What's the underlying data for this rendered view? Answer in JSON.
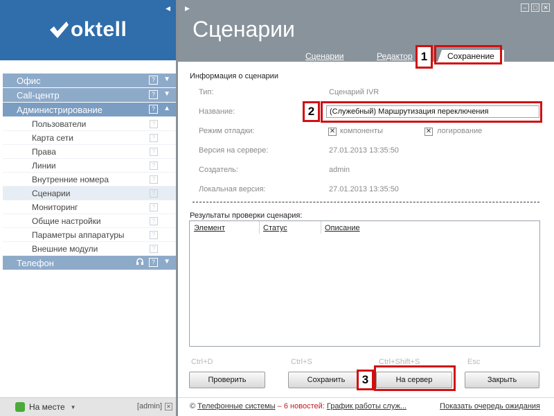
{
  "brand": {
    "logo_text": "oktell",
    "color_logo_bg": "#2f6dab",
    "color_header_bg": "#89939b"
  },
  "nav": {
    "sections": [
      {
        "label": "Офис"
      },
      {
        "label": "Call-центр"
      },
      {
        "label": "Администрирование"
      },
      {
        "label": "Телефон"
      }
    ],
    "admin_items": [
      {
        "label": "Пользователи"
      },
      {
        "label": "Карта сети"
      },
      {
        "label": "Права"
      },
      {
        "label": "Линии"
      },
      {
        "label": "Внутренние номера"
      },
      {
        "label": "Сценарии"
      },
      {
        "label": "Мониторинг"
      },
      {
        "label": "Общие настройки"
      },
      {
        "label": "Параметры аппаратуры"
      },
      {
        "label": "Внешние модули"
      }
    ],
    "help_glyph": "?"
  },
  "status": {
    "label": "На месте",
    "user": "[admin]"
  },
  "header": {
    "title": "Сценарии",
    "tabs": {
      "scenarios": "Сценарии",
      "editor": "Редактор",
      "save": "Сохранение"
    }
  },
  "info": {
    "title": "Информация о сценарии",
    "type_label": "Тип:",
    "type_value": "Сценарий IVR",
    "name_label": "Название:",
    "name_value": "(Служебный) Маршрутизация переключения",
    "debug_label": "Режим отладки:",
    "debug_components": "компоненты",
    "debug_logging": "логирование",
    "server_version_label": "Версия на сервере:",
    "server_version_value": "27.01.2013 13:35:50",
    "creator_label": "Создатель:",
    "creator_value": "admin",
    "local_version_label": "Локальная версия:",
    "local_version_value": "27.01.2013 13:35:50"
  },
  "results": {
    "title": "Результаты проверки сценария:",
    "columns": {
      "element": "Элемент",
      "status": "Статус",
      "description": "Описание"
    }
  },
  "actions": {
    "check": {
      "hint": "Ctrl+D",
      "label": "Проверить"
    },
    "save": {
      "hint": "Ctrl+S",
      "label": "Сохранить"
    },
    "server": {
      "hint": "Ctrl+Shift+S",
      "label": "На сервер"
    },
    "close": {
      "hint": "Esc",
      "label": "Закрыть"
    }
  },
  "callouts": {
    "one": "1",
    "two": "2",
    "three": "3"
  },
  "footer": {
    "copyright": "©",
    "company": "Телефонные системы",
    "dash": "–",
    "news": "6 новостей:",
    "news_link": "График работы служ...",
    "queue_link": "Показать очередь ожидания"
  }
}
